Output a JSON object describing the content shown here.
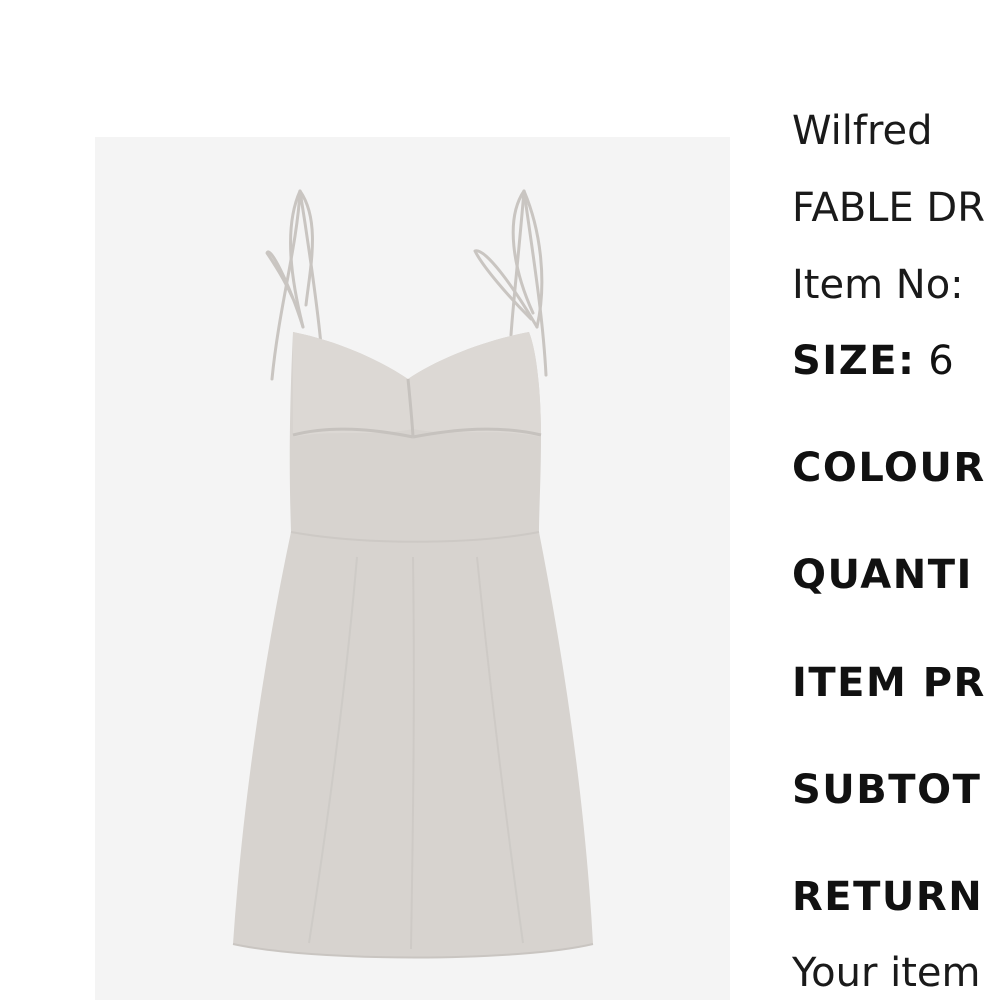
{
  "product": {
    "brand": "Wilfred",
    "name": "FABLE DR",
    "item_no_label": "Item No:",
    "size_label": "SIZE:",
    "size_value": "6",
    "colour_label": "COLOUR",
    "quantity_label": "QUANTI",
    "item_price_label": "ITEM PR",
    "subtotal_label": "SUBTOT",
    "returns_label": "RETURN",
    "returns_text": "Your item"
  },
  "colors": {
    "image_background": "#f4f4f4",
    "dress": "#d7d3cf",
    "text": "#111111"
  }
}
